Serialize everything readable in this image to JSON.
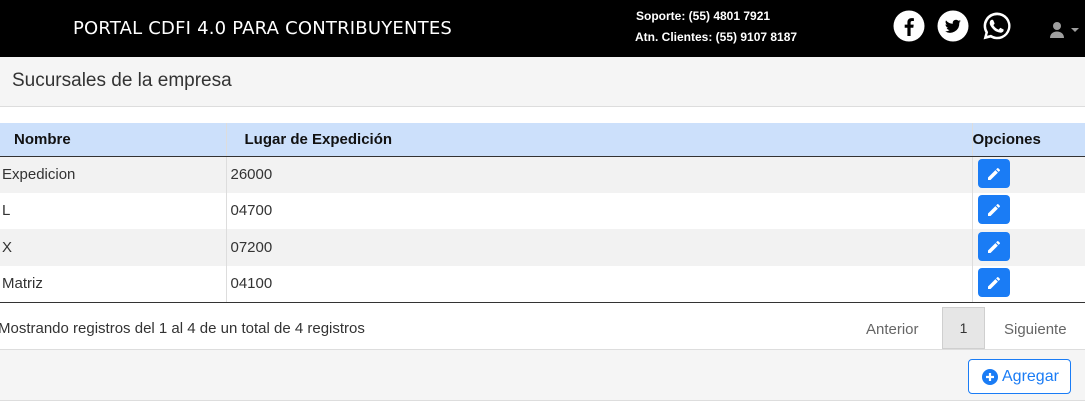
{
  "header": {
    "title": "PORTAL CDFI 4.0 PARA CONTRIBUYENTES",
    "support": "Soporte: (55) 4801 7921",
    "clients": "Atn. Clientes: (55) 9107 8187",
    "social_icons": [
      "facebook-icon",
      "twitter-icon",
      "whatsapp-icon"
    ],
    "user_icon": "user-icon"
  },
  "page": {
    "title": "Sucursales de la empresa"
  },
  "table": {
    "headers": [
      "Nombre",
      "Lugar de Expedición",
      "Opciones"
    ],
    "rows": [
      {
        "nombre": "Expedicion",
        "lugar": "26000"
      },
      {
        "nombre": "L",
        "lugar": "04700"
      },
      {
        "nombre": "X",
        "lugar": "07200"
      },
      {
        "nombre": "Matriz",
        "lugar": "04100"
      }
    ],
    "row_action_icon": "pencil-icon"
  },
  "pagination": {
    "info": "Mostrando registros del 1 al 4 de un total de 4 registros",
    "prev": "Anterior",
    "current": "1",
    "next": "Siguiente"
  },
  "footer": {
    "add_label": "Agregar"
  },
  "colors": {
    "header_bg": "#000000",
    "table_header_bg": "#cce0fb",
    "accent": "#1a7cf5"
  }
}
